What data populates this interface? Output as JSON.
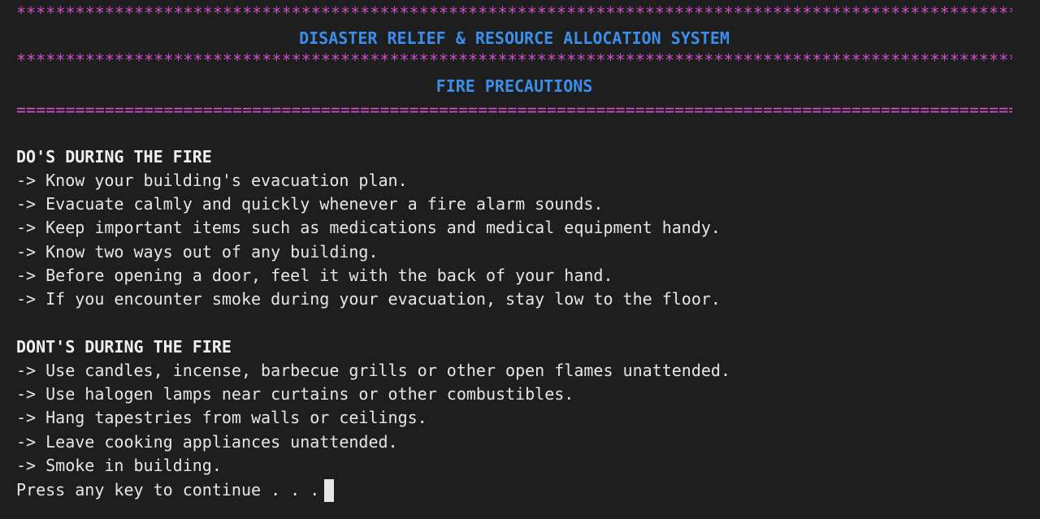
{
  "header": {
    "stars_top": "**************************************************************************************************************************",
    "app_title": "DISASTER RELIEF & RESOURCE ALLOCATION SYSTEM",
    "stars_bottom": "**************************************************************************************************************************",
    "section_title": "FIRE PRECAUTIONS",
    "equals_rule": "=========================================================================================================================="
  },
  "dos": {
    "heading": "DO'S DURING THE FIRE",
    "items": [
      "-> Know your building's evacuation plan.",
      "-> Evacuate calmly and quickly whenever a fire alarm sounds.",
      "-> Keep important items such as medications and medical equipment handy.",
      "-> Know two ways out of any building.",
      "-> Before opening a door, feel it with the back of your hand.",
      "-> If you encounter smoke during your evacuation, stay low to the floor."
    ]
  },
  "donts": {
    "heading": "DONT'S DURING THE FIRE",
    "items": [
      "-> Use candles, incense, barbecue grills or other open flames unattended.",
      "-> Use halogen lamps near curtains or other combustibles.",
      "-> Hang tapestries from walls or ceilings.",
      "-> Leave cooking appliances unattended.",
      "-> Smoke in building."
    ]
  },
  "prompt": {
    "text": "Press any key to continue . . ."
  },
  "colors": {
    "background": "#1e1e1e",
    "rule_magenta": "#cc4fc6",
    "title_blue": "#3b8eea",
    "text": "#e6e6e6"
  }
}
